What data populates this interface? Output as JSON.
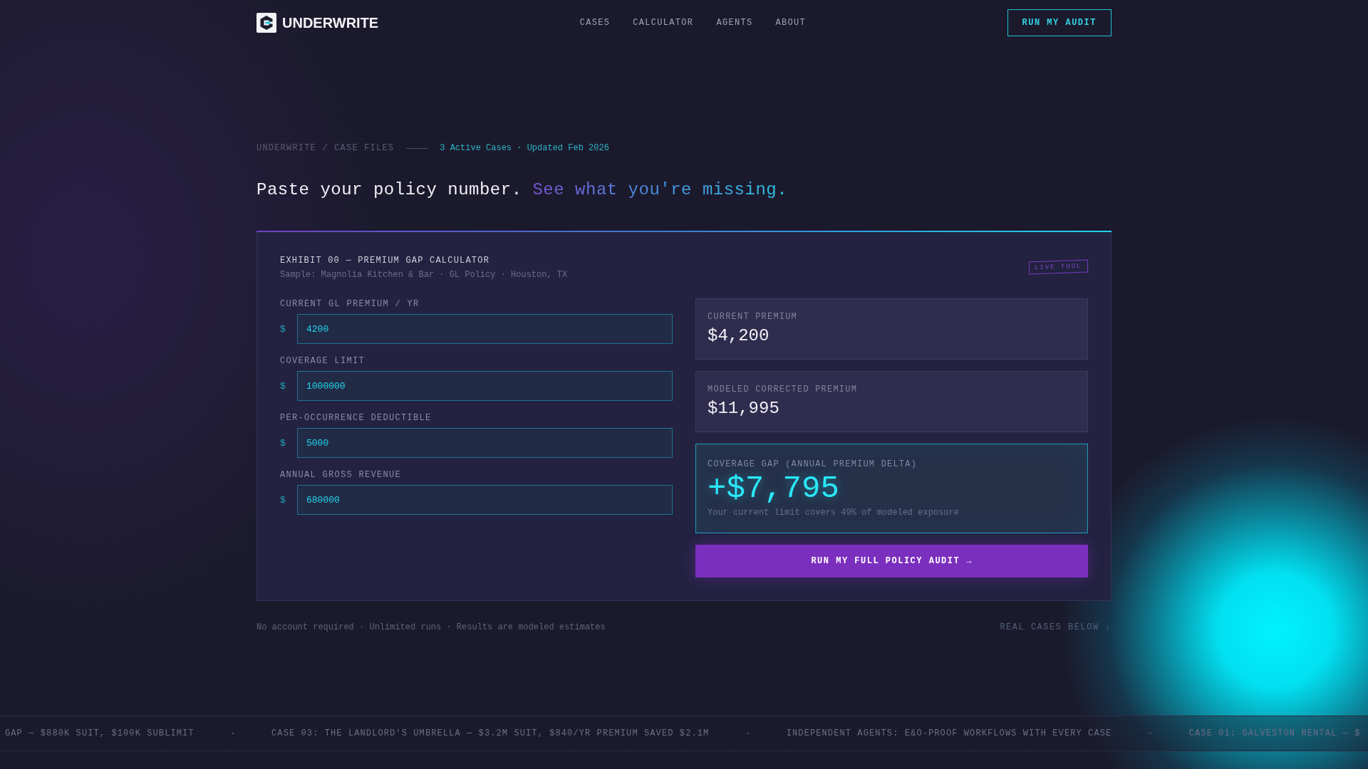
{
  "header": {
    "brand": "UNDERWRITE",
    "nav": [
      {
        "label": "CASES"
      },
      {
        "label": "CALCULATOR"
      },
      {
        "label": "AGENTS"
      },
      {
        "label": "ABOUT"
      }
    ],
    "cta": "RUN MY AUDIT"
  },
  "breadcrumb": {
    "path": "UNDERWRITE / CASE FILES",
    "status": "3 Active Cases · Updated Feb 2026"
  },
  "headline": {
    "lead": "Paste your policy number.",
    "accent": "See what you're missing."
  },
  "calculator": {
    "title": "EXHIBIT 00 — PREMIUM GAP CALCULATOR",
    "subtitle": "Sample: Magnolia Kitchen & Bar · GL Policy · Houston, TX",
    "badge": "LIVE TOOL",
    "fields": [
      {
        "label": "CURRENT GL PREMIUM / YR",
        "prefix": "$",
        "value": "4200"
      },
      {
        "label": "COVERAGE LIMIT",
        "prefix": "$",
        "value": "1000000"
      },
      {
        "label": "PER-OCCURRENCE DEDUCTIBLE",
        "prefix": "$",
        "value": "5000"
      },
      {
        "label": "ANNUAL GROSS REVENUE",
        "prefix": "$",
        "value": "680000"
      }
    ],
    "results": [
      {
        "kind": "stat",
        "label": "CURRENT PREMIUM",
        "value": "$4,200"
      },
      {
        "kind": "stat",
        "label": "MODELED CORRECTED PREMIUM",
        "value": "$11,995"
      },
      {
        "kind": "highlight",
        "label": "COVERAGE GAP (ANNUAL PREMIUM DELTA)",
        "value": "+$7,795",
        "note": "Your current limit covers 49% of modeled exposure"
      }
    ],
    "action": "RUN MY FULL POLICY AUDIT →"
  },
  "footnote": {
    "text": "No account required · Unlimited runs · Results are modeled estimates",
    "link": "REAL CASES BELOW ↓"
  },
  "ticker": [
    {
      "kind": "item",
      "text": "GAP — $880K SUIT, $100K SUBLIMIT"
    },
    {
      "kind": "separator",
      "text": "·"
    },
    {
      "kind": "item",
      "text": "CASE 03: THE LANDLORD'S UMBRELLA — $3.2M SUIT, $840/YR PREMIUM SAVED $2.1M"
    },
    {
      "kind": "separator",
      "text": "·"
    },
    {
      "kind": "item",
      "text": "INDEPENDENT AGENTS: E&O-PROOF WORKFLOWS WITH EVERY CASE"
    },
    {
      "kind": "separator",
      "text": "·"
    },
    {
      "kind": "item",
      "text": "CASE 01: GALVESTON RENTAL — $"
    }
  ]
}
